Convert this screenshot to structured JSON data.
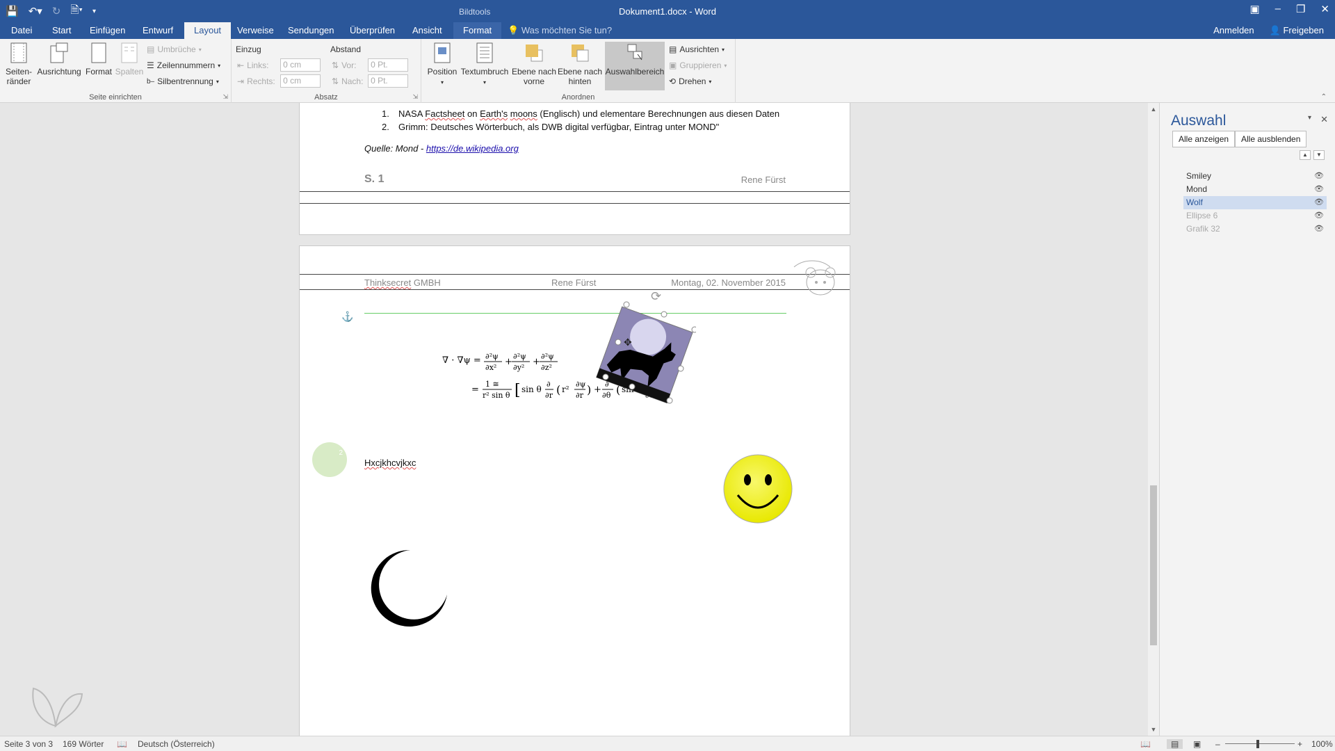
{
  "titlebar": {
    "context_label": "Bildtools",
    "doc_title": "Dokument1.docx - Word"
  },
  "tabs": [
    {
      "label": "Datei"
    },
    {
      "label": "Start"
    },
    {
      "label": "Einfügen"
    },
    {
      "label": "Entwurf"
    },
    {
      "label": "Layout"
    },
    {
      "label": "Verweise"
    },
    {
      "label": "Sendungen"
    },
    {
      "label": "Überprüfen"
    },
    {
      "label": "Ansicht"
    },
    {
      "label": "Format"
    }
  ],
  "tellme": "Was möchten Sie tun?",
  "account": {
    "signin": "Anmelden",
    "share": "Freigeben"
  },
  "ribbon": {
    "seite": {
      "label": "Seite einrichten",
      "seitenraender": "Seiten-\nränder",
      "ausrichtung": "Ausrichtung",
      "format": "Format",
      "spalten": "Spalten",
      "umbrueche": "Umbrüche",
      "zeilennummern": "Zeilennummern",
      "silbentrennung": "Silbentrennung"
    },
    "absatz": {
      "label": "Absatz",
      "einzug": "Einzug",
      "abstand": "Abstand",
      "links": "Links:",
      "rechts": "Rechts:",
      "vor": "Vor:",
      "nach": "Nach:",
      "links_val": "0 cm",
      "rechts_val": "0 cm",
      "vor_val": "0 Pt.",
      "nach_val": "0 Pt."
    },
    "anordnen": {
      "label": "Anordnen",
      "position": "Position",
      "textumbruch": "Textumbruch",
      "ebene_vorne": "Ebene nach\nvorne",
      "ebene_hinten": "Ebene nach\nhinten",
      "auswahlbereich": "Auswahlbereich",
      "ausrichten": "Ausrichten",
      "gruppieren": "Gruppieren",
      "drehen": "Drehen"
    }
  },
  "page1": {
    "items": [
      {
        "num": "1.",
        "pre": "NASA ",
        "sq1": "Factsheet",
        "mid": " on ",
        "sq2": "Earth's",
        "mid2": " ",
        "sq3": "moons",
        "post": " (Englisch) und elementare Berechnungen aus diesen Daten"
      },
      {
        "num": "2.",
        "text": "Grimm: Deutsches Wörterbuch, als DWB digital verfügbar, Eintrag unter MOND\""
      }
    ],
    "source_prefix": "Quelle: Mond - ",
    "source_link": "https://de.wikipedia.org",
    "footer_page": "S. 1",
    "footer_name": "Rene Fürst"
  },
  "page2": {
    "header_company_sq": "Thinksecret",
    "header_company_rest": " GMBH",
    "header_name": "Rene Fürst",
    "header_date": "Montag, 02. November 2015",
    "body_text": "Hxcjkhcvjkxc",
    "circle_num": "2"
  },
  "selection_pane": {
    "title": "Auswahl",
    "show_all": "Alle anzeigen",
    "hide_all": "Alle ausblenden",
    "items": [
      {
        "name": "Smiley",
        "state": "visible"
      },
      {
        "name": "Mond",
        "state": "visible"
      },
      {
        "name": "Wolf",
        "state": "selected"
      },
      {
        "name": "Ellipse 6",
        "state": "hidden"
      },
      {
        "name": "Grafik 32",
        "state": "hidden"
      }
    ]
  },
  "status": {
    "page": "Seite 3 von 3",
    "words": "169 Wörter",
    "language": "Deutsch (Österreich)",
    "zoom": "100%"
  },
  "colors": {
    "accent": "#2b579a",
    "smiley": "#f4f000"
  }
}
